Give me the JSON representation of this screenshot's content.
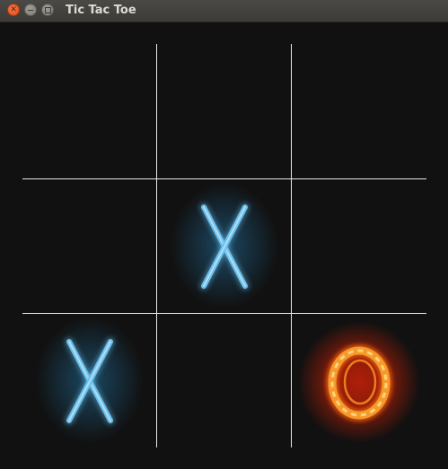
{
  "window": {
    "title": "Tic Tac Toe",
    "buttons": [
      "close",
      "minimize",
      "maximize"
    ]
  },
  "board": {
    "size": 3,
    "cells": [
      "",
      "",
      "",
      "",
      "X",
      "",
      "X",
      "",
      "O"
    ],
    "line_color": "#e8e8e8",
    "background": "#111111"
  },
  "marks": {
    "X": {
      "style": "neon tube",
      "color": "#6cc0ec",
      "glow": "#1b4a66"
    },
    "O": {
      "style": "fire",
      "color": "#f59a2c",
      "glow": "#b01f08"
    }
  }
}
